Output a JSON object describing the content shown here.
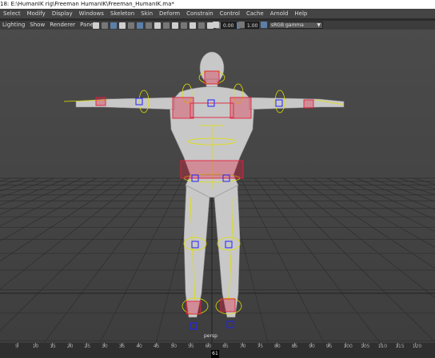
{
  "window": {
    "title": "18: E:\\HumanIK rig\\Freeman HumanIK\\Freeman_HumanIK.ma*"
  },
  "menubar": {
    "items": [
      {
        "label": "Select"
      },
      {
        "label": "Modify"
      },
      {
        "label": "Display"
      },
      {
        "label": "Windows"
      },
      {
        "label": "Skeleton"
      },
      {
        "label": "Skin"
      },
      {
        "label": "Deform"
      },
      {
        "label": "Constrain"
      },
      {
        "label": "Control"
      },
      {
        "label": "Cache"
      },
      {
        "label": "Arnold"
      },
      {
        "label": "Help"
      }
    ]
  },
  "panel": {
    "menus": [
      {
        "label": "Lighting"
      },
      {
        "label": "Show"
      },
      {
        "label": "Renderer"
      },
      {
        "label": "Panels"
      }
    ],
    "exposure_value": "0.00",
    "gamma_value": "1.00",
    "color_space": "sRGB gamma"
  },
  "viewport": {
    "camera_label": "persp"
  },
  "timeline": {
    "ticks": [
      "5",
      "10",
      "15",
      "20",
      "25",
      "30",
      "35",
      "40",
      "45",
      "50",
      "55",
      "60",
      "65",
      "70",
      "75",
      "80",
      "85",
      "90",
      "95",
      "100",
      "105",
      "110",
      "115",
      "120"
    ],
    "current_frame": "61"
  },
  "colors": {
    "ik_handle": "#e0203c",
    "fk_box": "#2020ff",
    "selection": "#e0e000",
    "body": "#c8c8c8"
  }
}
